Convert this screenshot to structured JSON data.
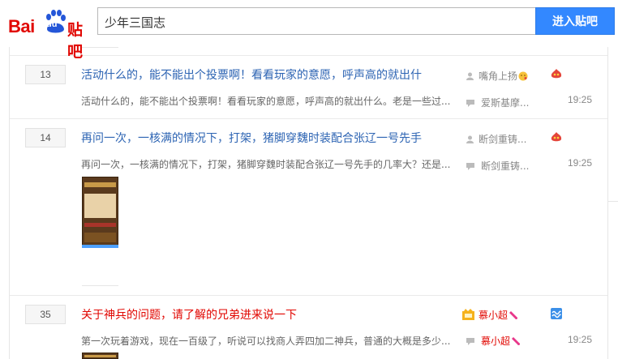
{
  "header": {
    "logo_bai": "Bai",
    "logo_du": "du",
    "logo_tieba": "贴吧",
    "search_value": "少年三国志",
    "search_button": "进入贴吧"
  },
  "threads": [
    {
      "reply_count": "13",
      "title": "活动什么的，能不能出个投票啊！看看玩家的意愿，呼声高的就出什",
      "excerpt": "活动什么的，能不能出个投票啊！看看玩家的意愿，呼声高的就出什么。老是一些过...",
      "author": "嘴角上扬",
      "last_reply_user": "爱斯基摩...",
      "time": "19:25",
      "badge": "flame-badge-icon"
    },
    {
      "reply_count": "14",
      "title": "再问一次，一核满的情况下，打架，猪脚穿魏时装配合张辽一号先手",
      "excerpt": "再问一次，一核满的情况下，打架，猪脚穿魏时装配合张辽一号先手的几率大？还是...",
      "author": "断剑重铸...",
      "last_reply_user": "断剑重铸...",
      "time": "19:25",
      "badge": "flame-badge-icon"
    },
    {
      "reply_count": "35",
      "title": "关于神兵的问题，请了解的兄弟进来说一下",
      "excerpt": "第一次玩着游戏，现在一百级了，听说可以找商人弄四加二神兵，普通的大概是多少...",
      "author": "慕小超",
      "last_reply_user": "慕小超",
      "time": "19:25",
      "badge": "wave-badge-icon"
    }
  ],
  "colors": {
    "brand_red": "#e10601",
    "link_blue": "#2d64b3",
    "button_blue": "#3388ff"
  }
}
